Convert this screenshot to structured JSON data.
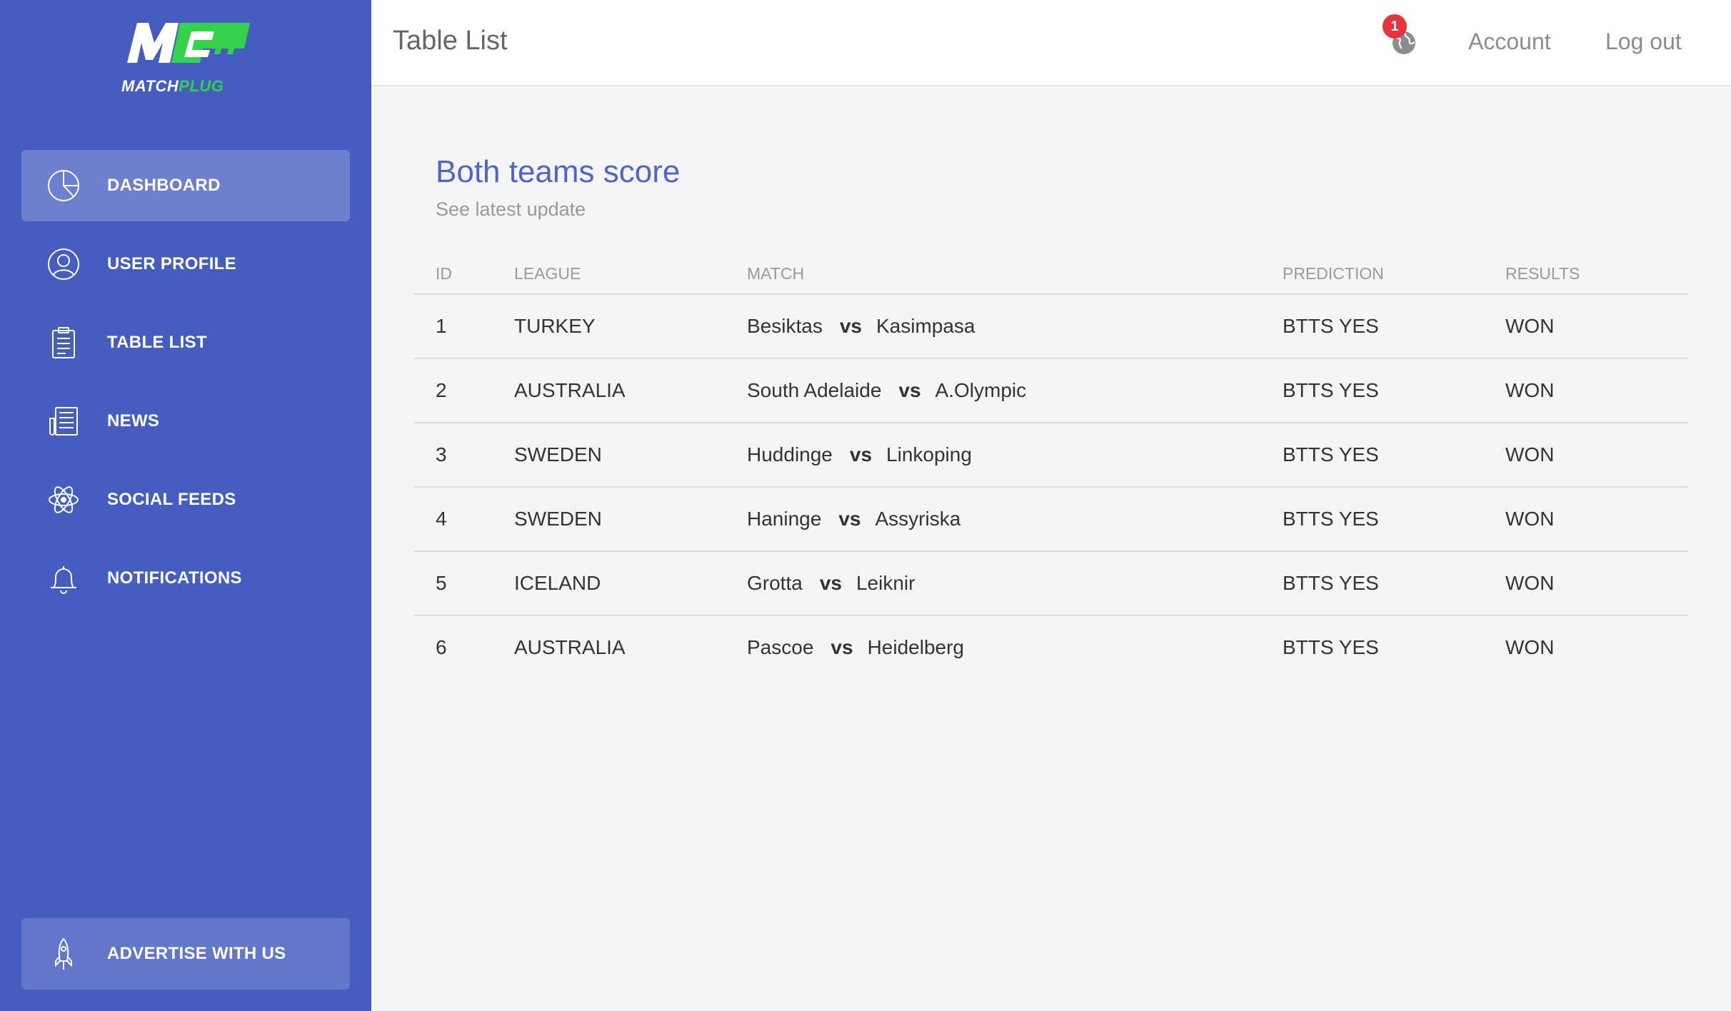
{
  "brand": {
    "logo_mark": "MC",
    "name_part1": "MATCH",
    "name_part2": "PLUG",
    "green": "#32d24a"
  },
  "sidebar": {
    "bg_color": "#445dbf",
    "items": [
      {
        "label": "DASHBOARD",
        "icon": "pie-chart-icon",
        "active": true
      },
      {
        "label": "USER PROFILE",
        "icon": "user-icon",
        "active": false
      },
      {
        "label": "TABLE LIST",
        "icon": "clipboard-icon",
        "active": false
      },
      {
        "label": "NEWS",
        "icon": "newspaper-icon",
        "active": false
      },
      {
        "label": "SOCIAL FEEDS",
        "icon": "atom-icon",
        "active": false
      },
      {
        "label": "NOTIFICATIONS",
        "icon": "bell-icon",
        "active": false
      }
    ],
    "advertise": {
      "label": "ADVERTISE WITH US",
      "icon": "rocket-icon"
    }
  },
  "header": {
    "title": "Table List",
    "notifications_count": "1",
    "account_label": "Account",
    "logout_label": "Log out"
  },
  "card": {
    "title": "Both teams score",
    "subtitle": "See latest update",
    "title_color": "#4f66c9"
  },
  "table": {
    "headers": [
      "ID",
      "LEAGUE",
      "MATCH",
      "PREDICTION",
      "RESULTS"
    ],
    "rows": [
      {
        "id": "1",
        "league": "TURKEY",
        "home": "Besiktas",
        "vs": "vs",
        "away": "Kasimpasa",
        "prediction": "BTTS YES",
        "result": "WON"
      },
      {
        "id": "2",
        "league": "AUSTRALIA",
        "home": "South Adelaide",
        "vs": "vs",
        "away": "A.Olympic",
        "prediction": "BTTS YES",
        "result": "WON"
      },
      {
        "id": "3",
        "league": "SWEDEN",
        "home": "Huddinge",
        "vs": "vs",
        "away": "Linkoping",
        "prediction": "BTTS YES",
        "result": "WON"
      },
      {
        "id": "4",
        "league": "SWEDEN",
        "home": "Haninge",
        "vs": "vs",
        "away": "Assyriska",
        "prediction": "BTTS YES",
        "result": "WON"
      },
      {
        "id": "5",
        "league": "ICELAND",
        "home": "Grotta",
        "vs": "vs",
        "away": "Leiknir",
        "prediction": "BTTS YES",
        "result": "WON"
      },
      {
        "id": "6",
        "league": "AUSTRALIA",
        "home": "Pascoe",
        "vs": "vs",
        "away": "Heidelberg",
        "prediction": "BTTS YES",
        "result": "WON"
      }
    ]
  }
}
